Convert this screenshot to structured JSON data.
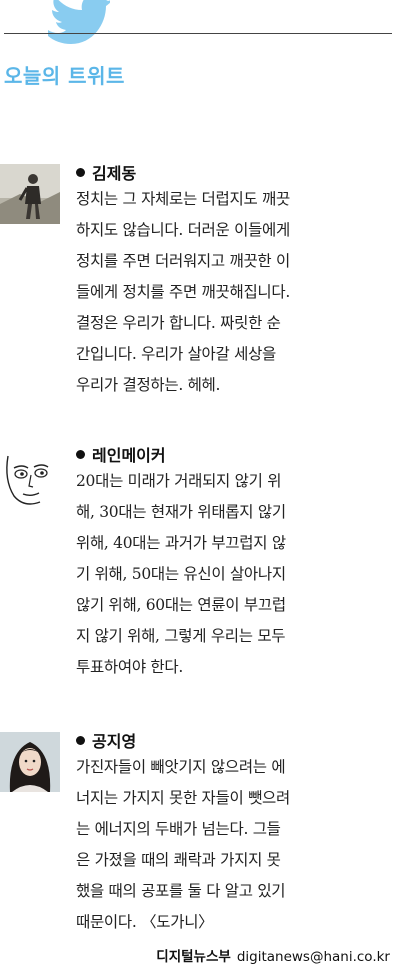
{
  "header": {
    "title": "오늘의 트위트",
    "logo_icon": "twitter-bird-icon",
    "accent_color": "#5bb6e8"
  },
  "entries": [
    {
      "name": "김제동",
      "avatar_icon": "hiker-photo-avatar",
      "lines": [
        "정치는 그 자체로는 더럽지도 깨끗",
        "하지도 않습니다. 더러운 이들에게",
        "정치를 주면 더러워지고 깨끗한 이",
        "들에게 정치를 주면 깨끗해집니다.",
        "결정은 우리가 합니다. 짜릿한 순",
        "간입니다. 우리가 살아갈 세상을",
        "우리가 결정하는. 헤헤."
      ]
    },
    {
      "name": "레인메이커",
      "avatar_icon": "sketched-face-avatar",
      "lines": [
        "20대는 미래가 거래되지 않기 위",
        "해, 30대는 현재가 위태롭지 않기",
        "위해, 40대는 과거가 부끄럽지 않",
        "기 위해, 50대는 유신이 살아나지",
        "않기 위해, 60대는 연륜이 부끄럽",
        "지 않기 위해, 그렇게 우리는 모두",
        "투표하여야 한다."
      ]
    },
    {
      "name": "공지영",
      "avatar_icon": "portrait-photo-avatar",
      "lines": [
        "가진자들이 빼앗기지 않으려는 에",
        "너지는 가지지 못한 자들이 뺏으려",
        "는 에너지의 두배가 넘는다. 그들",
        "은 가졌을 때의 쾌락과 가지지 못",
        "했을 때의 공포를 둘 다 알고 있기",
        "때문이다. 〈도가니〉"
      ]
    }
  ],
  "credit": {
    "department": "디지털뉴스부",
    "email": "digitanews@hani.co.kr"
  }
}
